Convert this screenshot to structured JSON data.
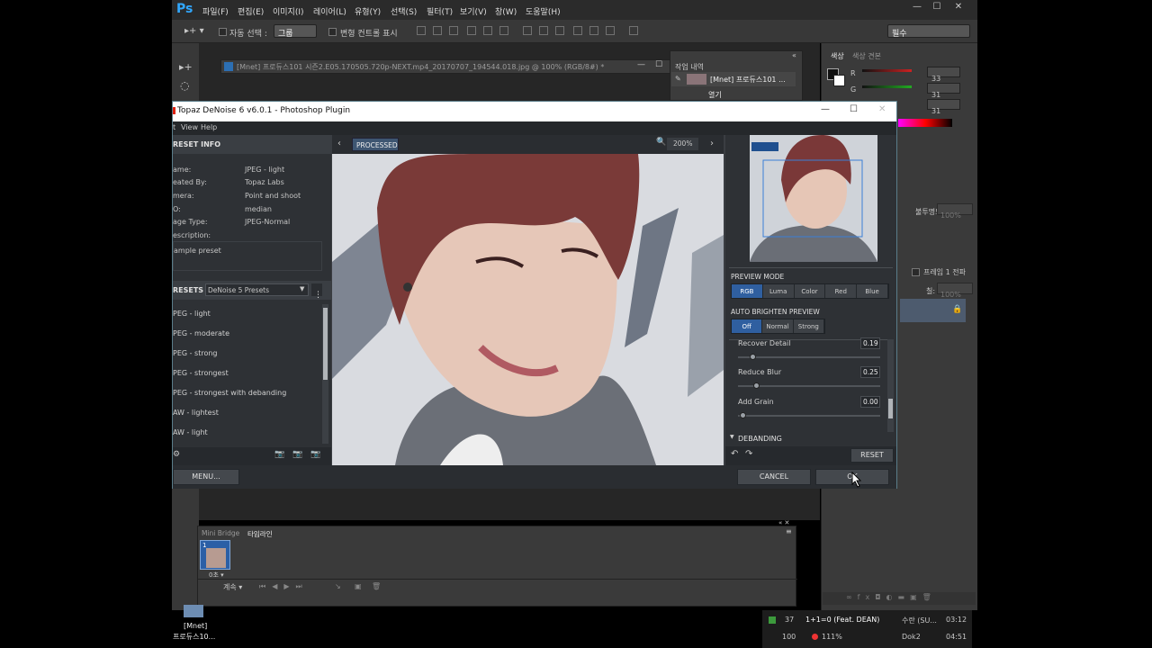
{
  "app": {
    "logo": "Ps",
    "menu": [
      "파일(F)",
      "편집(E)",
      "이미지(I)",
      "레이어(L)",
      "유형(Y)",
      "선택(S)",
      "필터(T)",
      "보기(V)",
      "창(W)",
      "도움말(H)"
    ],
    "window_controls": [
      "—",
      "☐",
      "✕"
    ]
  },
  "options": {
    "auto_select_label": "자동 선택 :",
    "auto_select_value": "그룹",
    "transform_label": "변형 컨트롤 표시",
    "workspace": "필수"
  },
  "document": {
    "tab_title": "[Mnet] 프로듀스101 시즌2.E05.170505.720p-NEXT.mp4_20170707_194544.018.jpg @ 100% (RGB/8#) *"
  },
  "history": {
    "tab": "작업 내역",
    "item1": "[Mnet] 프로듀스101 ...",
    "item2": "열기"
  },
  "color": {
    "tab_color": "색상",
    "tab_swatch": "색상 견본",
    "r_label": "R",
    "g_label": "G",
    "b_label": "B",
    "r": "33",
    "g": "31",
    "b": "31"
  },
  "layers": {
    "opacity_label": "불투명도:",
    "opacity_value": "100%",
    "frame_label": "프레임 1 전파",
    "fill_label": "칠:",
    "fill_value": "100%"
  },
  "plugin": {
    "title": "Topaz DeNoise 6 v6.0.1 - Photoshop Plugin",
    "menu": [
      "t",
      "View",
      "Help"
    ],
    "preset_info_header": "RESET INFO",
    "info": [
      {
        "k": "ame:",
        "v": "JPEG - light"
      },
      {
        "k": "eated By:",
        "v": "Topaz Labs"
      },
      {
        "k": "mera:",
        "v": "Point and shoot"
      },
      {
        "k": "O:",
        "v": "median"
      },
      {
        "k": "age Type:",
        "v": "JPEG-Normal"
      },
      {
        "k": "escription:",
        "v": ""
      }
    ],
    "description": "ample preset",
    "presets_header": "RESETS",
    "presets_group": "DeNoise 5 Presets",
    "presets": [
      "PEG - light",
      "PEG - moderate",
      "PEG - strong",
      "PEG - strongest",
      "PEG - strongest with debanding",
      "AW - lightest",
      "AW - light"
    ],
    "view_label": "PROCESSED",
    "zoom": "200%",
    "preview_mode_header": "PREVIEW MODE",
    "preview_modes": [
      "RGB",
      "Luma",
      "Color",
      "Red",
      "Blue"
    ],
    "brighten_header": "AUTO BRIGHTEN PREVIEW",
    "brighten_modes": [
      "Off",
      "Normal",
      "Strong"
    ],
    "sliders": [
      {
        "label": "Recover Detail",
        "value": "0.19",
        "pos": 0.19
      },
      {
        "label": "Reduce Blur",
        "value": "0.25",
        "pos": 0.25
      },
      {
        "label": "Add Grain",
        "value": "0.00",
        "pos": 0.0
      }
    ],
    "debanding_header": "DEBANDING",
    "reset": "RESET",
    "menu_btn": "MENU...",
    "cancel": "CANCEL",
    "ok": "OK"
  },
  "bridge": {
    "tab1": "Mini Bridge",
    "tab2": "타임라인",
    "frame_num": "1",
    "frame_time": "0초 ▾",
    "loop": "계속"
  },
  "desktop": {
    "icon_line1": "[Mnet]",
    "icon_line2": "프로듀스10..."
  },
  "taskbar": {
    "row1": {
      "num": "37",
      "title": "1+1=0 (Feat. DEAN)",
      "artist": "수란 (SU...",
      "time": "03:12"
    },
    "row2": {
      "num": "100",
      "zoom": "111%",
      "name": "Dok2",
      "time": "04:51"
    }
  }
}
